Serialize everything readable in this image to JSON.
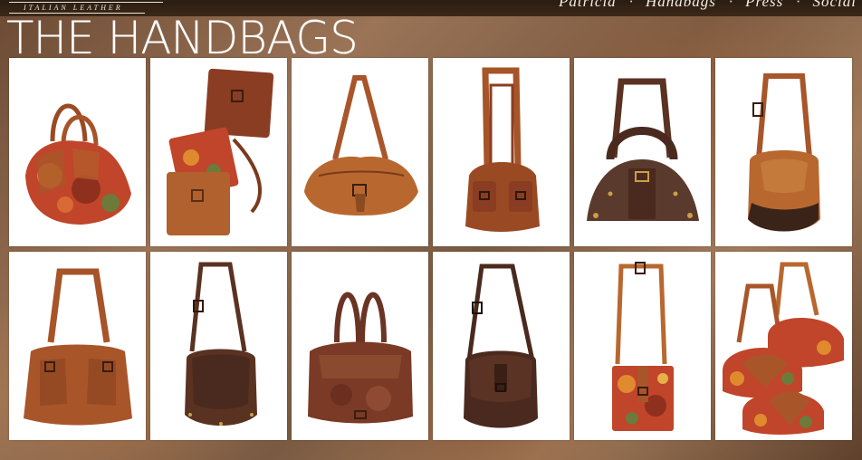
{
  "header": {
    "logo_tagline": "ITALIAN LEATHER",
    "nav": [
      {
        "label": "Patricia"
      },
      {
        "label": "Handbags"
      },
      {
        "label": "Press"
      },
      {
        "label": "Social"
      }
    ],
    "nav_separator": "·"
  },
  "page": {
    "title": "THE HANDBAGS"
  },
  "colors": {
    "tan": "#a9552a",
    "cognac": "#b8682f",
    "dark_brown": "#5a3222",
    "chocolate": "#4a2a1e",
    "floral_red": "#c0452a",
    "floral_orange": "#e08a30",
    "floral_green": "#6c7a3a"
  },
  "grid": {
    "rows": 2,
    "columns": 6,
    "items": [
      {
        "icon": "floral-duffel-bag-icon"
      },
      {
        "icon": "three-crossbody-bags-icon"
      },
      {
        "icon": "cognac-hobo-bag-icon"
      },
      {
        "icon": "pocket-shoulder-bag-icon"
      },
      {
        "icon": "brown-frame-satchel-icon"
      },
      {
        "icon": "tan-saddle-bag-icon"
      },
      {
        "icon": "pocket-tote-bag-icon"
      },
      {
        "icon": "brown-messenger-bag-icon"
      },
      {
        "icon": "leather-shopper-bag-icon"
      },
      {
        "icon": "dark-flap-bag-icon"
      },
      {
        "icon": "floral-crossbody-bag-icon"
      },
      {
        "icon": "floral-frame-bags-icon"
      }
    ]
  }
}
